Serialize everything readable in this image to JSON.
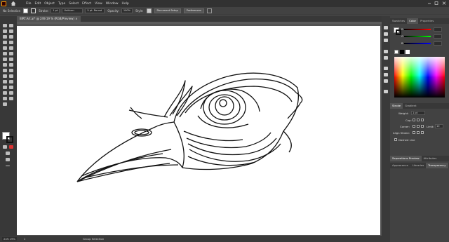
{
  "menubar": {
    "items": [
      "File",
      "Edit",
      "Object",
      "Type",
      "Select",
      "Effect",
      "View",
      "Window",
      "Help"
    ]
  },
  "controlbar": {
    "selection": "No Selection",
    "stroke_label": "Stroke:",
    "stroke_weight": "1 pt",
    "uniform": "Uniform",
    "brush": "5 pt. Round",
    "opacity_label": "Opacity:",
    "opacity_value": "100%",
    "style_label": "Style:",
    "document_setup": "Document Setup",
    "preferences": "Preferences"
  },
  "document": {
    "tab_title": "BIRT.Art.ai* @ 249.19 % (RGB/Preview)"
  },
  "status": {
    "zoom": "249.19%",
    "artboard": "1",
    "tool": "Group Selection"
  },
  "panels": {
    "top_tabs": [
      "Swatches",
      "Color",
      "Properties"
    ],
    "active_top_tab": "Color",
    "stroke_tabs": [
      "Stroke",
      "Gradient"
    ],
    "weight_label": "Weight:",
    "weight_value": "1 pt",
    "cap_label": "Cap:",
    "corner_label": "Corner:",
    "limit_label": "Limit:",
    "limit_value": "10",
    "align_label": "Align Stroke:",
    "dashed_label": "Dashed Line",
    "bottom_tabs_1": [
      "Separations Preview",
      "Attributes"
    ],
    "bottom_tabs_2": [
      "Appearance",
      "Libraries",
      "Transparency"
    ]
  },
  "colors": {
    "accent_logo": "#ff9a00",
    "ui_dark": "#323232",
    "artboard": "#ffffff"
  }
}
